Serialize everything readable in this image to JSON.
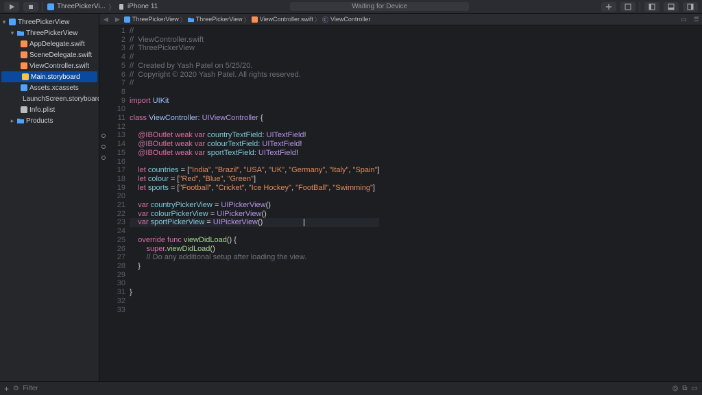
{
  "toolbar": {
    "scheme_target": "ThreePickerVi...",
    "scheme_device": "iPhone 11",
    "status": "Waiting for Device"
  },
  "jumpbar": {
    "items": [
      "ThreePickerView",
      "ThreePickerView",
      "ViewController.swift",
      "ViewController"
    ]
  },
  "sidebar": {
    "root": "ThreePickerView",
    "group": "ThreePickerView",
    "files": [
      "AppDelegate.swift",
      "SceneDelegate.swift",
      "ViewController.swift",
      "Main.storyboard",
      "Assets.xcassets",
      "LaunchScreen.storyboard",
      "Info.plist"
    ],
    "products": "Products",
    "selected": "Main.storyboard"
  },
  "bottom": {
    "filter_placeholder": "Filter"
  },
  "code": {
    "lines": [
      {
        "n": 1,
        "seg": [
          {
            "c": "c-comm",
            "t": "//"
          }
        ]
      },
      {
        "n": 2,
        "seg": [
          {
            "c": "c-comm",
            "t": "//  ViewController.swift"
          }
        ]
      },
      {
        "n": 3,
        "seg": [
          {
            "c": "c-comm",
            "t": "//  ThreePickerView"
          }
        ]
      },
      {
        "n": 4,
        "seg": [
          {
            "c": "c-comm",
            "t": "//"
          }
        ]
      },
      {
        "n": 5,
        "seg": [
          {
            "c": "c-comm",
            "t": "//  Created by Yash Patel on 5/25/20."
          }
        ]
      },
      {
        "n": 6,
        "seg": [
          {
            "c": "c-comm",
            "t": "//  Copyright © 2020 Yash Patel. All rights reserved."
          }
        ]
      },
      {
        "n": 7,
        "seg": [
          {
            "c": "c-comm",
            "t": "//"
          }
        ]
      },
      {
        "n": 8,
        "seg": [
          {
            "c": "c-plain",
            "t": " "
          }
        ]
      },
      {
        "n": 9,
        "seg": [
          {
            "c": "c-key",
            "t": "import"
          },
          {
            "c": "c-plain",
            "t": " "
          },
          {
            "c": "c-type",
            "t": "UIKit"
          }
        ]
      },
      {
        "n": 10,
        "seg": [
          {
            "c": "c-plain",
            "t": " "
          }
        ]
      },
      {
        "n": 11,
        "seg": [
          {
            "c": "c-key",
            "t": "class"
          },
          {
            "c": "c-plain",
            "t": " "
          },
          {
            "c": "c-type",
            "t": "ViewController"
          },
          {
            "c": "c-plain",
            "t": ": "
          },
          {
            "c": "c-type2",
            "t": "UIViewController"
          },
          {
            "c": "c-plain",
            "t": " {"
          }
        ]
      },
      {
        "n": 12,
        "seg": [
          {
            "c": "c-plain",
            "t": " "
          }
        ]
      },
      {
        "n": 13,
        "dot": true,
        "seg": [
          {
            "c": "c-plain",
            "t": "    "
          },
          {
            "c": "c-key",
            "t": "@IBOutlet weak var"
          },
          {
            "c": "c-plain",
            "t": " "
          },
          {
            "c": "c-id",
            "t": "countryTextField"
          },
          {
            "c": "c-plain",
            "t": ": "
          },
          {
            "c": "c-type2",
            "t": "UITextField"
          },
          {
            "c": "c-plain",
            "t": "!"
          }
        ]
      },
      {
        "n": 14,
        "dot": true,
        "seg": [
          {
            "c": "c-plain",
            "t": "    "
          },
          {
            "c": "c-key",
            "t": "@IBOutlet weak var"
          },
          {
            "c": "c-plain",
            "t": " "
          },
          {
            "c": "c-id",
            "t": "colourTextField"
          },
          {
            "c": "c-plain",
            "t": ": "
          },
          {
            "c": "c-type2",
            "t": "UITextField"
          },
          {
            "c": "c-plain",
            "t": "!"
          }
        ]
      },
      {
        "n": 15,
        "dot": true,
        "seg": [
          {
            "c": "c-plain",
            "t": "    "
          },
          {
            "c": "c-key",
            "t": "@IBOutlet weak var"
          },
          {
            "c": "c-plain",
            "t": " "
          },
          {
            "c": "c-id",
            "t": "sportTextField"
          },
          {
            "c": "c-plain",
            "t": ": "
          },
          {
            "c": "c-type2",
            "t": "UITextField"
          },
          {
            "c": "c-plain",
            "t": "!"
          }
        ]
      },
      {
        "n": 16,
        "seg": [
          {
            "c": "c-plain",
            "t": " "
          }
        ]
      },
      {
        "n": 17,
        "seg": [
          {
            "c": "c-plain",
            "t": "    "
          },
          {
            "c": "c-key",
            "t": "let"
          },
          {
            "c": "c-plain",
            "t": " "
          },
          {
            "c": "c-id",
            "t": "countries"
          },
          {
            "c": "c-plain",
            "t": " = ["
          },
          {
            "c": "c-str",
            "t": "\"India\""
          },
          {
            "c": "c-plain",
            "t": ", "
          },
          {
            "c": "c-str",
            "t": "\"Brazil\""
          },
          {
            "c": "c-plain",
            "t": ", "
          },
          {
            "c": "c-str",
            "t": "\"USA\""
          },
          {
            "c": "c-plain",
            "t": ", "
          },
          {
            "c": "c-str",
            "t": "\"UK\""
          },
          {
            "c": "c-plain",
            "t": ", "
          },
          {
            "c": "c-str",
            "t": "\"Germany\""
          },
          {
            "c": "c-plain",
            "t": ", "
          },
          {
            "c": "c-str",
            "t": "\"Italy\""
          },
          {
            "c": "c-plain",
            "t": ", "
          },
          {
            "c": "c-str",
            "t": "\"Spain\""
          },
          {
            "c": "c-plain",
            "t": "]"
          }
        ]
      },
      {
        "n": 18,
        "seg": [
          {
            "c": "c-plain",
            "t": "    "
          },
          {
            "c": "c-key",
            "t": "let"
          },
          {
            "c": "c-plain",
            "t": " "
          },
          {
            "c": "c-id",
            "t": "colour"
          },
          {
            "c": "c-plain",
            "t": " = ["
          },
          {
            "c": "c-str",
            "t": "\"Red\""
          },
          {
            "c": "c-plain",
            "t": ", "
          },
          {
            "c": "c-str",
            "t": "\"Blue\""
          },
          {
            "c": "c-plain",
            "t": ", "
          },
          {
            "c": "c-str",
            "t": "\"Green\""
          },
          {
            "c": "c-plain",
            "t": "]"
          }
        ]
      },
      {
        "n": 19,
        "seg": [
          {
            "c": "c-plain",
            "t": "    "
          },
          {
            "c": "c-key",
            "t": "let"
          },
          {
            "c": "c-plain",
            "t": " "
          },
          {
            "c": "c-id",
            "t": "sports"
          },
          {
            "c": "c-plain",
            "t": " = ["
          },
          {
            "c": "c-str",
            "t": "\"Football\""
          },
          {
            "c": "c-plain",
            "t": ", "
          },
          {
            "c": "c-str",
            "t": "\"Cricket\""
          },
          {
            "c": "c-plain",
            "t": ", "
          },
          {
            "c": "c-str",
            "t": "\"Ice Hockey\""
          },
          {
            "c": "c-plain",
            "t": ", "
          },
          {
            "c": "c-str",
            "t": "\"FootBall\""
          },
          {
            "c": "c-plain",
            "t": ", "
          },
          {
            "c": "c-str",
            "t": "\"Swimming\""
          },
          {
            "c": "c-plain",
            "t": "]"
          }
        ]
      },
      {
        "n": 20,
        "seg": [
          {
            "c": "c-plain",
            "t": " "
          }
        ]
      },
      {
        "n": 21,
        "seg": [
          {
            "c": "c-plain",
            "t": "    "
          },
          {
            "c": "c-key",
            "t": "var"
          },
          {
            "c": "c-plain",
            "t": " "
          },
          {
            "c": "c-id",
            "t": "countryPickerView"
          },
          {
            "c": "c-plain",
            "t": " = "
          },
          {
            "c": "c-type2",
            "t": "UIPickerView"
          },
          {
            "c": "c-plain",
            "t": "()"
          }
        ]
      },
      {
        "n": 22,
        "seg": [
          {
            "c": "c-plain",
            "t": "    "
          },
          {
            "c": "c-key",
            "t": "var"
          },
          {
            "c": "c-plain",
            "t": " "
          },
          {
            "c": "c-id",
            "t": "colourPickerView"
          },
          {
            "c": "c-plain",
            "t": " = "
          },
          {
            "c": "c-type2",
            "t": "UIPickerView"
          },
          {
            "c": "c-plain",
            "t": "()"
          }
        ]
      },
      {
        "n": 23,
        "cur": true,
        "seg": [
          {
            "c": "c-plain",
            "t": "    "
          },
          {
            "c": "c-key",
            "t": "var"
          },
          {
            "c": "c-plain",
            "t": " "
          },
          {
            "c": "c-id",
            "t": "sportPickerView"
          },
          {
            "c": "c-plain",
            "t": " = "
          },
          {
            "c": "c-type2",
            "t": "UIPickerView"
          },
          {
            "c": "c-plain",
            "t": "()"
          }
        ]
      },
      {
        "n": 24,
        "seg": [
          {
            "c": "c-plain",
            "t": " "
          }
        ]
      },
      {
        "n": 25,
        "seg": [
          {
            "c": "c-plain",
            "t": "    "
          },
          {
            "c": "c-key",
            "t": "override func"
          },
          {
            "c": "c-plain",
            "t": " "
          },
          {
            "c": "c-func",
            "t": "viewDidLoad"
          },
          {
            "c": "c-plain",
            "t": "() {"
          }
        ]
      },
      {
        "n": 26,
        "seg": [
          {
            "c": "c-plain",
            "t": "        "
          },
          {
            "c": "c-super",
            "t": "super"
          },
          {
            "c": "c-plain",
            "t": "."
          },
          {
            "c": "c-func",
            "t": "viewDidLoad"
          },
          {
            "c": "c-plain",
            "t": "()"
          }
        ]
      },
      {
        "n": 27,
        "seg": [
          {
            "c": "c-plain",
            "t": "        "
          },
          {
            "c": "c-comm",
            "t": "// Do any additional setup after loading the view."
          }
        ]
      },
      {
        "n": 28,
        "seg": [
          {
            "c": "c-plain",
            "t": "    }"
          }
        ]
      },
      {
        "n": 29,
        "seg": [
          {
            "c": "c-plain",
            "t": " "
          }
        ]
      },
      {
        "n": 30,
        "seg": [
          {
            "c": "c-plain",
            "t": " "
          }
        ]
      },
      {
        "n": 31,
        "seg": [
          {
            "c": "c-plain",
            "t": "}"
          }
        ]
      },
      {
        "n": 32,
        "seg": [
          {
            "c": "c-plain",
            "t": " "
          }
        ]
      },
      {
        "n": 33,
        "seg": [
          {
            "c": "c-plain",
            "t": " "
          }
        ]
      }
    ]
  }
}
